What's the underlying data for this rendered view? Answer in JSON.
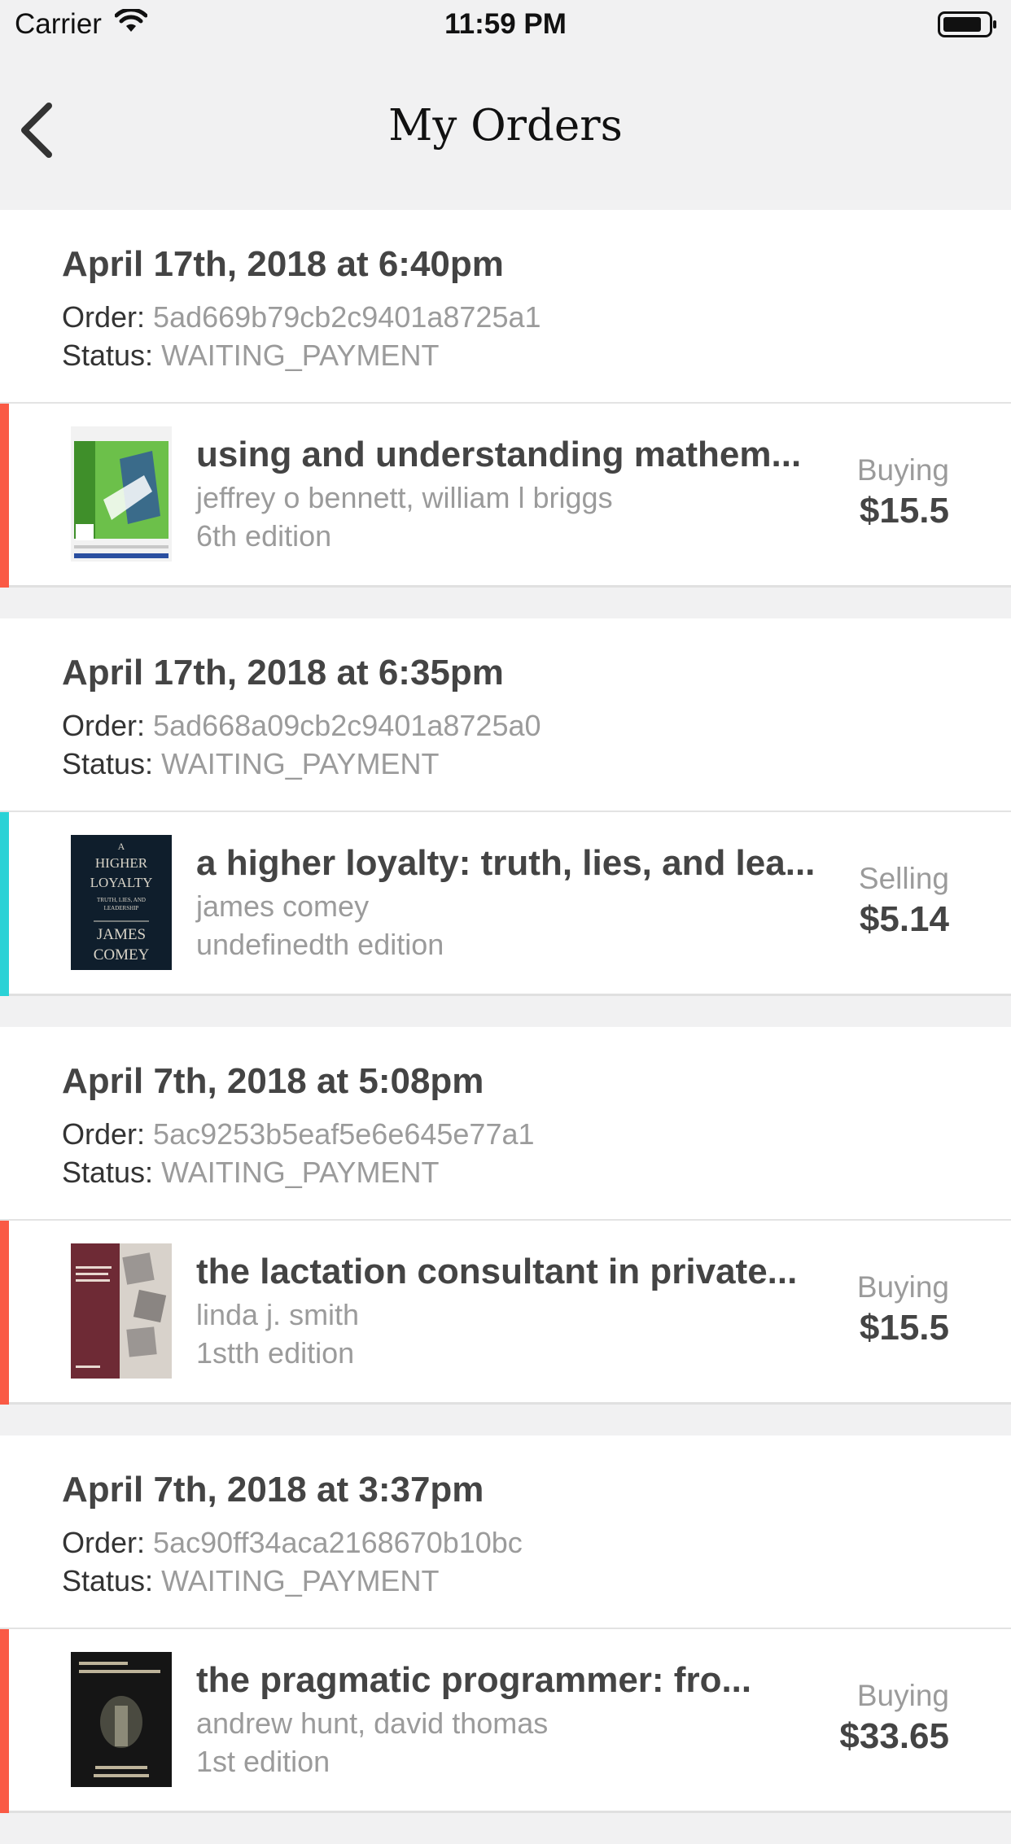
{
  "status_bar": {
    "carrier": "Carrier",
    "time": "11:59 PM"
  },
  "nav": {
    "title": "My Orders"
  },
  "labels": {
    "order": "Order:",
    "status": "Status:"
  },
  "colors": {
    "buying_accent": "#fa5a45",
    "selling_accent": "#2ad2d6",
    "text_dark": "#444444",
    "text_muted": "#9b9b9b",
    "background": "#f1f1f2"
  },
  "orders": [
    {
      "date": "April 17th, 2018 at 6:40pm",
      "order_id": "5ad669b79cb2c9401a8725a1",
      "status": "WAITING_PAYMENT",
      "item": {
        "title": "using and understanding mathem...",
        "authors": "jeffrey o bennett, william l briggs",
        "edition": "6th edition",
        "type": "Buying",
        "price": "$15.5",
        "accent": "buying",
        "cover_icon": "math-book-cover"
      }
    },
    {
      "date": "April 17th, 2018 at 6:35pm",
      "order_id": "5ad668a09cb2c9401a8725a0",
      "status": "WAITING_PAYMENT",
      "item": {
        "title": "a higher loyalty: truth, lies, and lea...",
        "authors": "james comey",
        "edition": "undefinedth edition",
        "type": "Selling",
        "price": "$5.14",
        "accent": "selling",
        "cover_icon": "higher-loyalty-book-cover",
        "cover_text": [
          "A",
          "HIGHER",
          "LOYALTY",
          "TRUTH, LIES, AND",
          "LEADERSHIP",
          "JAMES",
          "COMEY"
        ]
      }
    },
    {
      "date": "April 7th, 2018 at 5:08pm",
      "order_id": "5ac9253b5eaf5e6e645e77a1",
      "status": "WAITING_PAYMENT",
      "item": {
        "title": "the lactation consultant in private...",
        "authors": "linda j. smith",
        "edition": "1stth edition",
        "type": "Buying",
        "price": "$15.5",
        "accent": "buying",
        "cover_icon": "lactation-book-cover"
      }
    },
    {
      "date": "April 7th, 2018 at 3:37pm",
      "order_id": "5ac90ff34aca2168670b10bc",
      "status": "WAITING_PAYMENT",
      "item": {
        "title": "the pragmatic programmer: fro...",
        "authors": "andrew hunt, david thomas",
        "edition": "1st edition",
        "type": "Buying",
        "price": "$33.65",
        "accent": "buying",
        "cover_icon": "pragmatic-programmer-book-cover"
      }
    }
  ]
}
